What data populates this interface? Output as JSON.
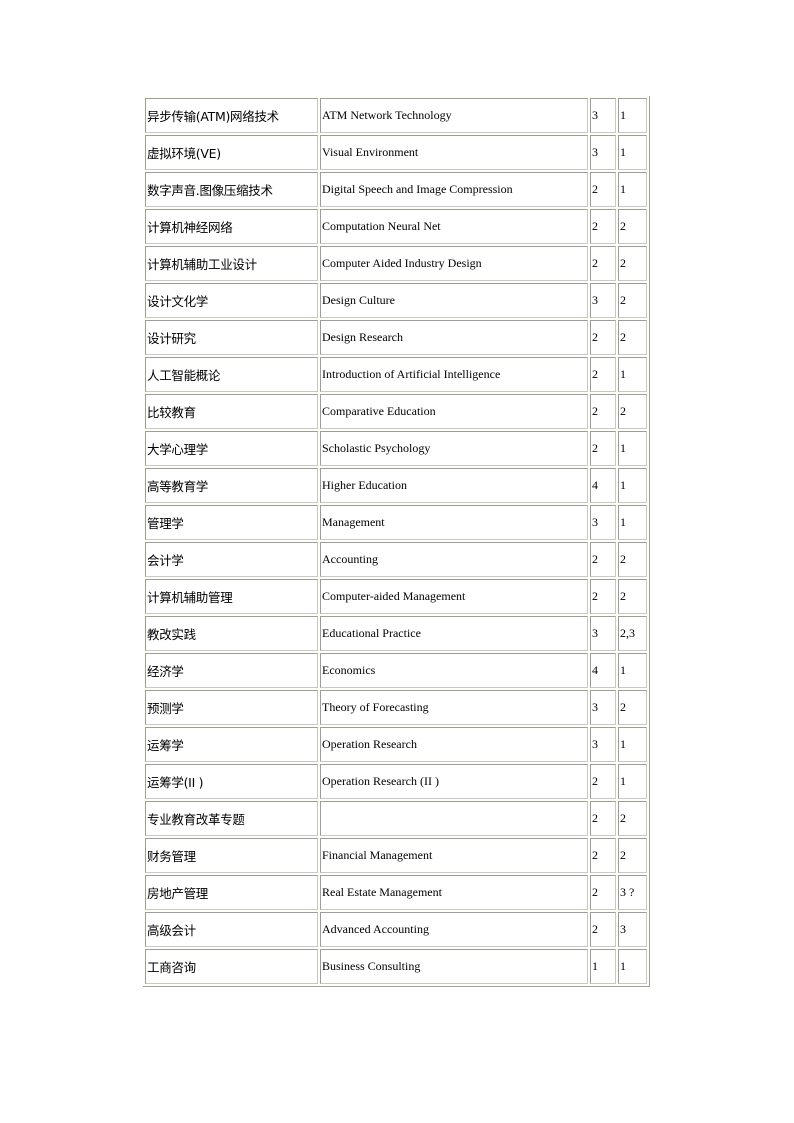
{
  "table": {
    "rows": [
      {
        "cn": "异步传输(ATM)网络技术",
        "en": "ATM Network Technology",
        "credit": "3",
        "term": "1"
      },
      {
        "cn": "虚拟环境(VE)",
        "en": "Visual Environment",
        "credit": "3",
        "term": "1"
      },
      {
        "cn": "数字声音.图像压缩技术",
        "en": "Digital Speech and Image Compression",
        "credit": "2",
        "term": "1"
      },
      {
        "cn": "计算机神经网络",
        "en": "Computation  Neural Net",
        "credit": "2",
        "term": "2"
      },
      {
        "cn": "计算机辅助工业设计",
        "en": "Computer  Aided Industry Design",
        "credit": "2",
        "term": "2"
      },
      {
        "cn": "设计文化学",
        "en": "Design Culture",
        "credit": "3",
        "term": "2"
      },
      {
        "cn": "设计研究",
        "en": "Design Research",
        "credit": "2",
        "term": "2"
      },
      {
        "cn": "人工智能概论",
        "en": "Introduction of Artificial  Intelligence",
        "credit": "2",
        "term": "1"
      },
      {
        "cn": "比较教育",
        "en": "Comparative  Education",
        "credit": "2",
        "term": "2"
      },
      {
        "cn": "大学心理学",
        "en": "Scholastic  Psychology",
        "credit": "2",
        "term": "1"
      },
      {
        "cn": "高等教育学",
        "en": "Higher Education",
        "credit": "4",
        "term": "1"
      },
      {
        "cn": "管理学",
        "en": "Management",
        "credit": "3",
        "term": "1"
      },
      {
        "cn": "会计学",
        "en": "Accounting",
        "credit": "2",
        "term": "2"
      },
      {
        "cn": "计算机辅助管理",
        "en": "Computer-aided  Management",
        "credit": "2",
        "term": "2"
      },
      {
        "cn": "教改实践",
        "en": "Educational  Practice",
        "credit": "3",
        "term": "2,3"
      },
      {
        "cn": "经济学",
        "en": "Economics",
        "credit": "4",
        "term": "1"
      },
      {
        "cn": "预测学",
        "en": "Theory of Forecasting",
        "credit": "3",
        "term": "2"
      },
      {
        "cn": "运筹学",
        "en": "Operation  Research",
        "credit": "3",
        "term": "1"
      },
      {
        "cn": "运筹学(II )",
        "en": "Operation Research  (II )",
        "credit": "2",
        "term": "1"
      },
      {
        "cn": "专业教育改革专题",
        "en": "",
        "credit": "2",
        "term": "2"
      },
      {
        "cn": "财务管理",
        "en": "Financial  Management",
        "credit": "2",
        "term": "2"
      },
      {
        "cn": "房地产管理",
        "en": "Real Estate  Management",
        "credit": "2",
        "term": "3 ?"
      },
      {
        "cn": "高级会计",
        "en": "Advanced  Accounting",
        "credit": "2",
        "term": "3"
      },
      {
        "cn": "工商咨询",
        "en": "Business Consulting",
        "credit": "1",
        "term": "1"
      }
    ]
  }
}
